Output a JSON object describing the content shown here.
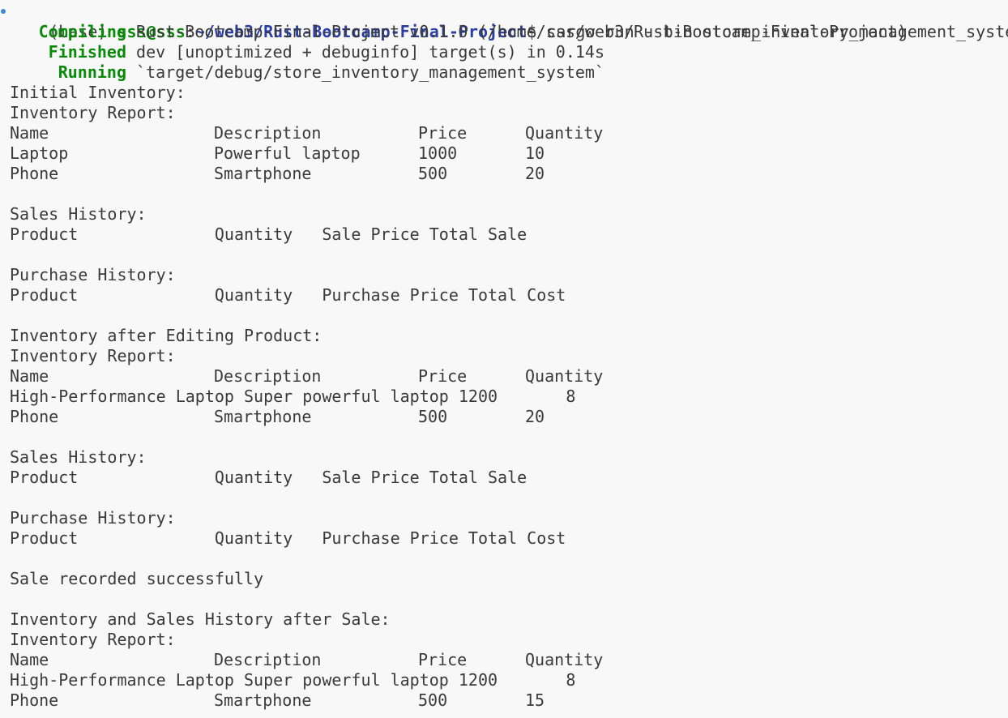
{
  "prompt": {
    "env": "(base)",
    "user_host": "sss@sss",
    "path": "~/web3/Rust-Bootcamp-Final-Project",
    "symbol": "$",
    "command": "cargo run --bin store_inventory_management_system"
  },
  "cargo": [
    {
      "status": "Compiling",
      "text": "Rust-Bootcamp-Final-Project v0.1.0 (/home/sss/web3/Rust-Bootcamp-Final-Project)"
    },
    {
      "status": "Finished",
      "text": "dev [unoptimized + debuginfo] target(s) in 0.14s"
    },
    {
      "status": "Running",
      "text": "`target/debug/store_inventory_management_system`"
    }
  ],
  "output": {
    "initial_inventory": "Initial Inventory:",
    "inventory_report": "Inventory Report:",
    "sales_history": "Sales History:",
    "purchase_history": "Purchase History:",
    "after_editing": "Inventory after Editing Product:",
    "sale_recorded": "Sale recorded successfully",
    "after_sale": "Inventory and Sales History after Sale:",
    "inventory_headers": [
      "Name",
      "Description",
      "Price",
      "Quantity"
    ],
    "sales_header": "Product              Quantity   Sale Price Total Sale",
    "purchase_header": "Product              Quantity   Purchase Price Total Cost",
    "inventory_1": [
      [
        "Laptop",
        "Powerful laptop",
        "1000",
        "10"
      ],
      [
        "Phone",
        "Smartphone",
        "500",
        "20"
      ]
    ],
    "inventory_2": [
      "High-Performance Laptop Super powerful laptop 1200       8",
      [
        "Phone",
        "Smartphone",
        "500",
        "20"
      ]
    ],
    "inventory_3": [
      "High-Performance Laptop Super powerful laptop 1200       8",
      [
        "Phone",
        "Smartphone",
        "500",
        "15"
      ]
    ]
  }
}
